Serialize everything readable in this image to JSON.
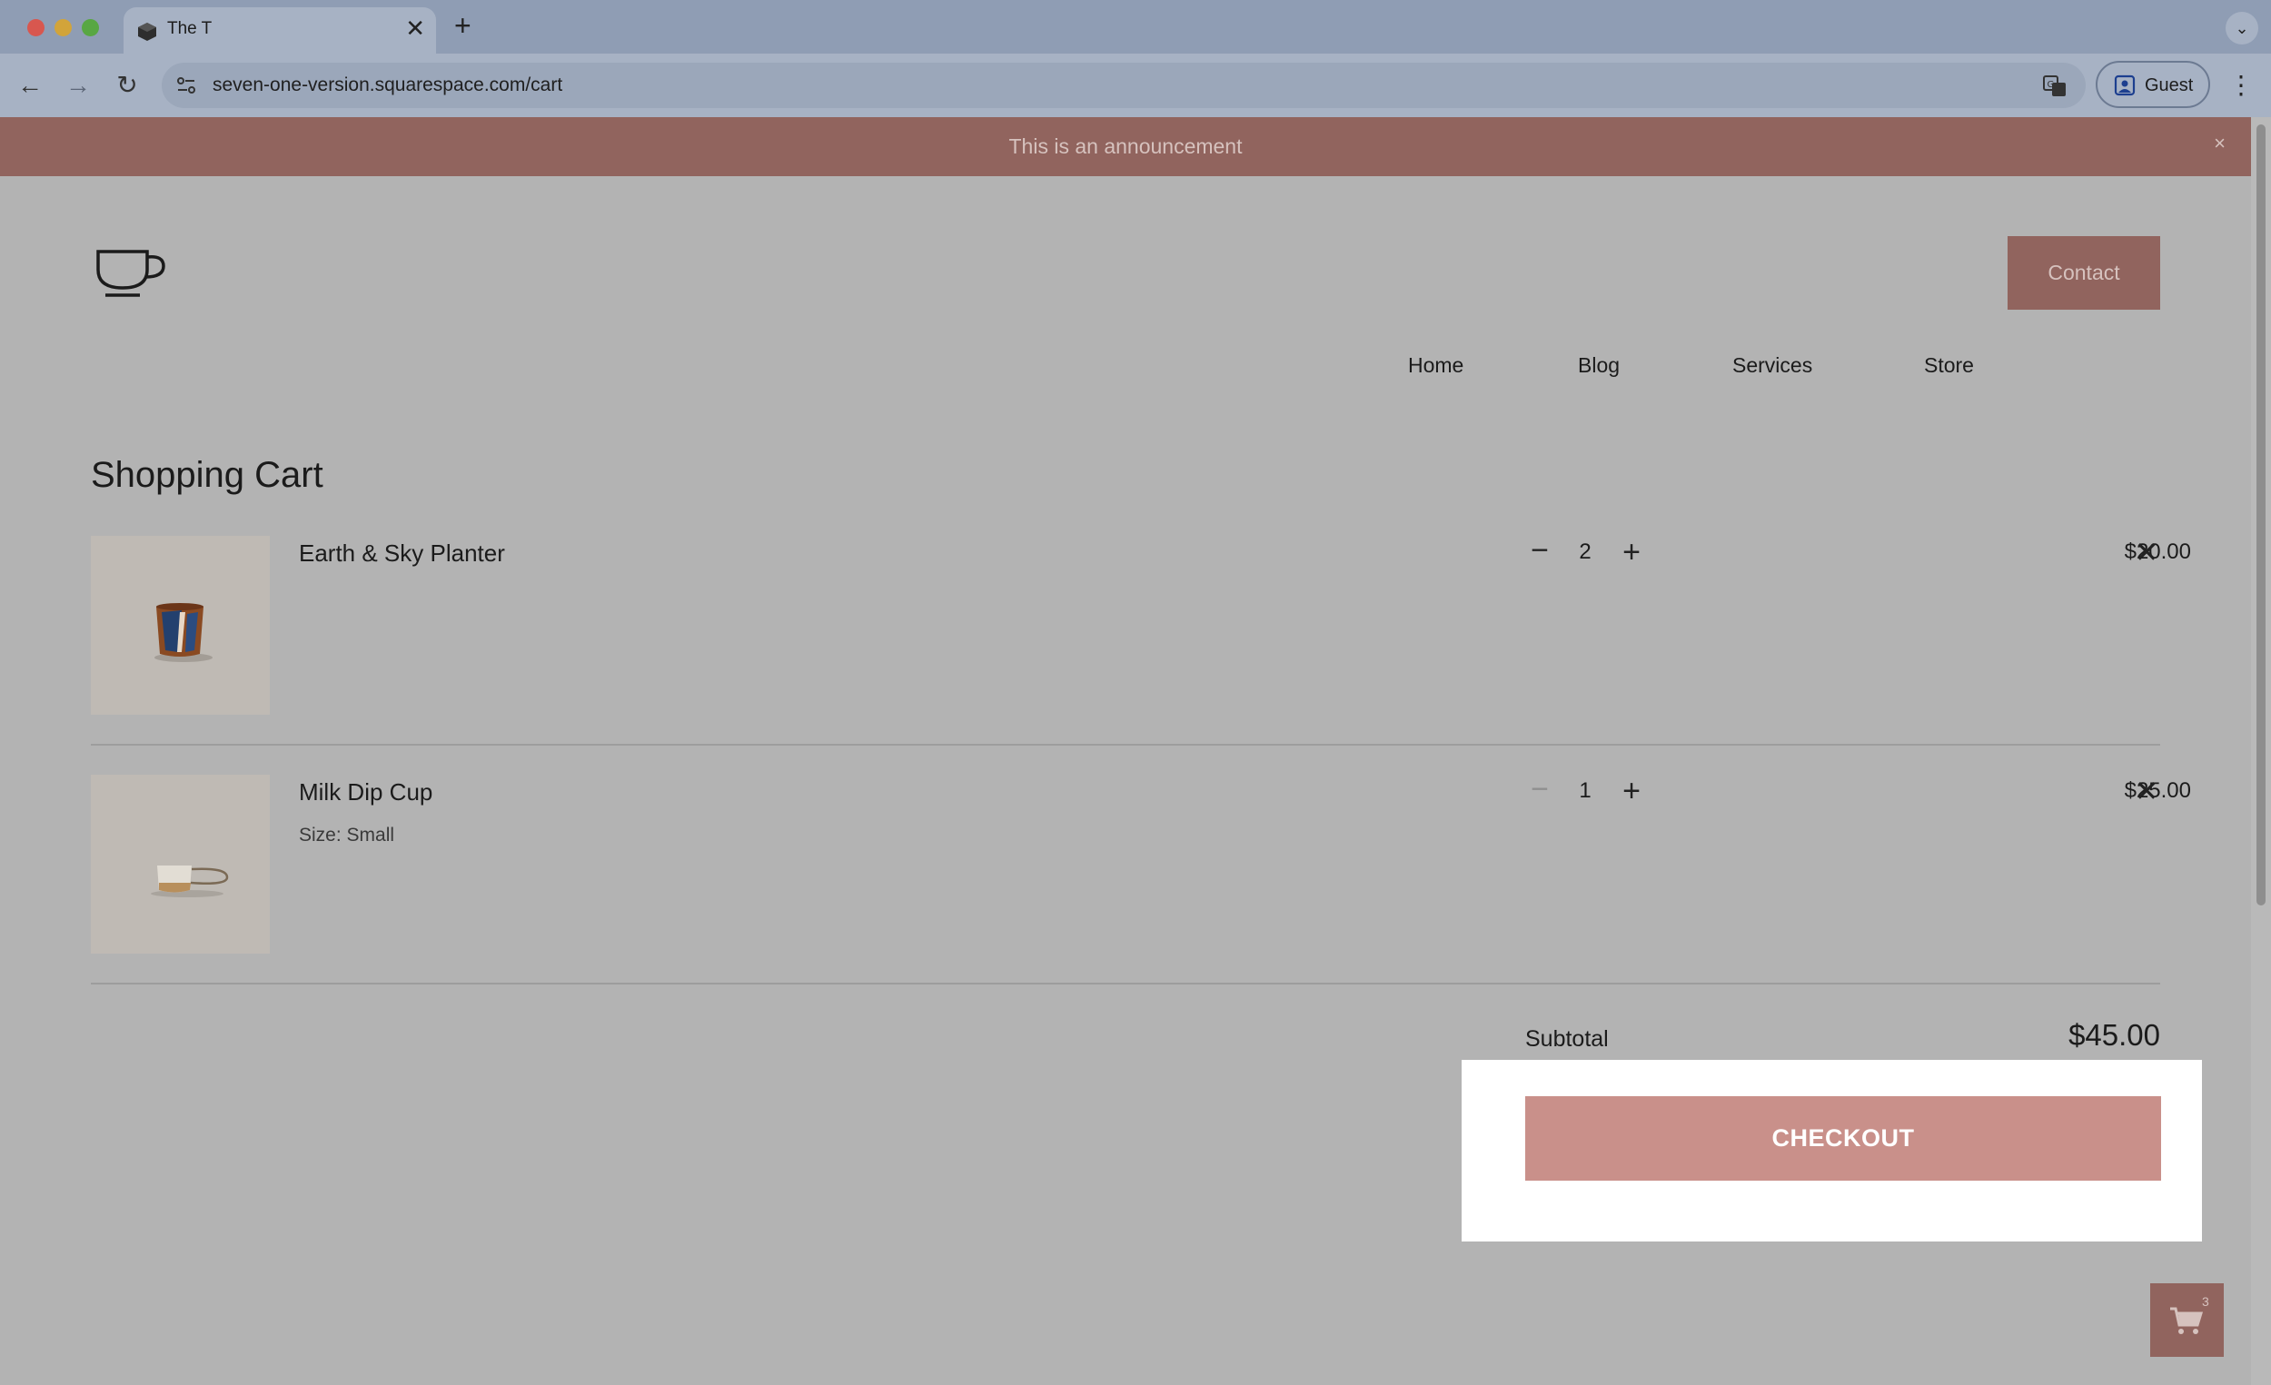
{
  "browser": {
    "tab_title": "The T",
    "tab_close": "✕",
    "new_tab": "+",
    "tab_dropdown": "⌄",
    "back": "←",
    "forward": "→",
    "reload": "↻",
    "url": "seven-one-version.squarespace.com/cart",
    "profile_label": "Guest",
    "menu": "⋮"
  },
  "site": {
    "announcement": "This is an announcement",
    "announcement_close": "×",
    "nav": {
      "home": "Home",
      "blog": "Blog",
      "services": "Services",
      "store": "Store",
      "contact": "Contact"
    }
  },
  "cart": {
    "title": "Shopping Cart",
    "items": [
      {
        "name": "Earth & Sky Planter",
        "option": "",
        "quantity": "2",
        "price": "$20.00",
        "minus": "−",
        "plus": "+",
        "remove": "✕"
      },
      {
        "name": "Milk Dip Cup",
        "option": "Size: Small",
        "quantity": "1",
        "price": "$25.00",
        "minus": "−",
        "plus": "+",
        "remove": "✕"
      }
    ],
    "subtotal_label": "Subtotal",
    "subtotal_value": "$45.00",
    "checkout_label": "CHECKOUT",
    "cart_count": "3"
  },
  "colors": {
    "accent": "#91645e",
    "checkout": "#c9908a",
    "overlay": "#b3b3b3"
  },
  "icons": {
    "logo": "coffee-cup-icon",
    "favicon": "cube-icon",
    "site_info": "tune-icon",
    "translate": "translate-icon",
    "profile": "person-icon",
    "cart": "shopping-cart-icon"
  }
}
